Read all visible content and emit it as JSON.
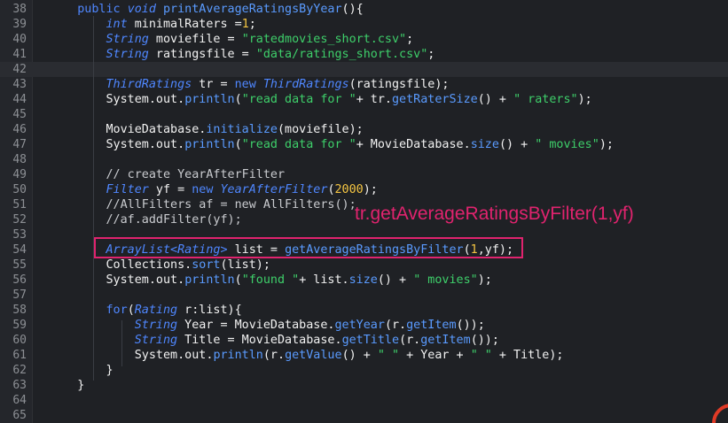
{
  "editor": {
    "current_line": "42",
    "lines": [
      {
        "num": "38",
        "tokens": [
          {
            "t": "    ",
            "c": "pl"
          },
          {
            "t": "public",
            "c": "kw"
          },
          {
            "t": " ",
            "c": "pl"
          },
          {
            "t": "void",
            "c": "ty"
          },
          {
            "t": " ",
            "c": "pl"
          },
          {
            "t": "printAverageRatingsByYear",
            "c": "fn"
          },
          {
            "t": "(){",
            "c": "pl"
          }
        ]
      },
      {
        "num": "39",
        "tokens": [
          {
            "t": "        ",
            "c": "pl"
          },
          {
            "t": "int",
            "c": "ty"
          },
          {
            "t": " minimalRaters ",
            "c": "pl"
          },
          {
            "t": "=",
            "c": "pl"
          },
          {
            "t": "1",
            "c": "nm"
          },
          {
            "t": ";",
            "c": "pl"
          }
        ]
      },
      {
        "num": "40",
        "tokens": [
          {
            "t": "        ",
            "c": "pl"
          },
          {
            "t": "String",
            "c": "ty"
          },
          {
            "t": " moviefile = ",
            "c": "pl"
          },
          {
            "t": "\"ratedmovies_short.csv\"",
            "c": "st"
          },
          {
            "t": ";",
            "c": "pl"
          }
        ]
      },
      {
        "num": "41",
        "tokens": [
          {
            "t": "        ",
            "c": "pl"
          },
          {
            "t": "String",
            "c": "ty"
          },
          {
            "t": " ratingsfile = ",
            "c": "pl"
          },
          {
            "t": "\"data/ratings_short.csv\"",
            "c": "st"
          },
          {
            "t": ";",
            "c": "pl"
          }
        ]
      },
      {
        "num": "42",
        "tokens": []
      },
      {
        "num": "43",
        "tokens": [
          {
            "t": "        ",
            "c": "pl"
          },
          {
            "t": "ThirdRatings",
            "c": "ty"
          },
          {
            "t": " tr = ",
            "c": "pl"
          },
          {
            "t": "new",
            "c": "kw"
          },
          {
            "t": " ",
            "c": "pl"
          },
          {
            "t": "ThirdRatings",
            "c": "ty"
          },
          {
            "t": "(ratingsfile);",
            "c": "pl"
          }
        ]
      },
      {
        "num": "44",
        "tokens": [
          {
            "t": "        System.out.",
            "c": "pl"
          },
          {
            "t": "println",
            "c": "fn"
          },
          {
            "t": "(",
            "c": "pl"
          },
          {
            "t": "\"read data for \"",
            "c": "st"
          },
          {
            "t": "+ tr.",
            "c": "pl"
          },
          {
            "t": "getRaterSize",
            "c": "fn"
          },
          {
            "t": "() + ",
            "c": "pl"
          },
          {
            "t": "\" raters\"",
            "c": "st"
          },
          {
            "t": ");",
            "c": "pl"
          }
        ]
      },
      {
        "num": "45",
        "tokens": []
      },
      {
        "num": "46",
        "tokens": [
          {
            "t": "        MovieDatabase.",
            "c": "pl"
          },
          {
            "t": "initialize",
            "c": "fn"
          },
          {
            "t": "(moviefile);",
            "c": "pl"
          }
        ]
      },
      {
        "num": "47",
        "tokens": [
          {
            "t": "        System.out.",
            "c": "pl"
          },
          {
            "t": "println",
            "c": "fn"
          },
          {
            "t": "(",
            "c": "pl"
          },
          {
            "t": "\"read data for \"",
            "c": "st"
          },
          {
            "t": "+ MovieDatabase.",
            "c": "pl"
          },
          {
            "t": "size",
            "c": "fn"
          },
          {
            "t": "() + ",
            "c": "pl"
          },
          {
            "t": "\" movies\"",
            "c": "st"
          },
          {
            "t": ");",
            "c": "pl"
          }
        ]
      },
      {
        "num": "48",
        "tokens": []
      },
      {
        "num": "49",
        "tokens": [
          {
            "t": "        // create YearAfterFilter",
            "c": "cm"
          }
        ]
      },
      {
        "num": "50",
        "tokens": [
          {
            "t": "        ",
            "c": "pl"
          },
          {
            "t": "Filter",
            "c": "ty"
          },
          {
            "t": " yf = ",
            "c": "pl"
          },
          {
            "t": "new",
            "c": "kw"
          },
          {
            "t": " ",
            "c": "pl"
          },
          {
            "t": "YearAfterFilter",
            "c": "ty"
          },
          {
            "t": "(",
            "c": "pl"
          },
          {
            "t": "2000",
            "c": "nm"
          },
          {
            "t": ");",
            "c": "pl"
          }
        ]
      },
      {
        "num": "51",
        "tokens": [
          {
            "t": "        //AllFilters af = new AllFilters();",
            "c": "cm"
          }
        ]
      },
      {
        "num": "52",
        "tokens": [
          {
            "t": "        //af.addFilter(yf);",
            "c": "cm"
          }
        ]
      },
      {
        "num": "53",
        "tokens": []
      },
      {
        "num": "54",
        "tokens": [
          {
            "t": "        ",
            "c": "pl"
          },
          {
            "t": "ArrayList<Rating>",
            "c": "ty"
          },
          {
            "t": " list = ",
            "c": "pl"
          },
          {
            "t": "getAverageRatingsByFilter",
            "c": "fn"
          },
          {
            "t": "(",
            "c": "pl"
          },
          {
            "t": "1",
            "c": "nm"
          },
          {
            "t": ",yf);",
            "c": "pl"
          }
        ]
      },
      {
        "num": "55",
        "tokens": [
          {
            "t": "        Collections.",
            "c": "pl"
          },
          {
            "t": "sort",
            "c": "fn"
          },
          {
            "t": "(list);",
            "c": "pl"
          }
        ]
      },
      {
        "num": "56",
        "tokens": [
          {
            "t": "        System.out.",
            "c": "pl"
          },
          {
            "t": "println",
            "c": "fn"
          },
          {
            "t": "(",
            "c": "pl"
          },
          {
            "t": "\"found \"",
            "c": "st"
          },
          {
            "t": "+ list.",
            "c": "pl"
          },
          {
            "t": "size",
            "c": "fn"
          },
          {
            "t": "() + ",
            "c": "pl"
          },
          {
            "t": "\" movies\"",
            "c": "st"
          },
          {
            "t": ");",
            "c": "pl"
          }
        ]
      },
      {
        "num": "57",
        "tokens": []
      },
      {
        "num": "58",
        "tokens": [
          {
            "t": "        ",
            "c": "pl"
          },
          {
            "t": "for",
            "c": "kw"
          },
          {
            "t": "(",
            "c": "pl"
          },
          {
            "t": "Rating",
            "c": "ty"
          },
          {
            "t": " r:list){",
            "c": "pl"
          }
        ]
      },
      {
        "num": "59",
        "tokens": [
          {
            "t": "            ",
            "c": "pl"
          },
          {
            "t": "String",
            "c": "ty"
          },
          {
            "t": " Year = MovieDatabase.",
            "c": "pl"
          },
          {
            "t": "getYear",
            "c": "fn"
          },
          {
            "t": "(r.",
            "c": "pl"
          },
          {
            "t": "getItem",
            "c": "fn"
          },
          {
            "t": "());",
            "c": "pl"
          }
        ]
      },
      {
        "num": "60",
        "tokens": [
          {
            "t": "            ",
            "c": "pl"
          },
          {
            "t": "String",
            "c": "ty"
          },
          {
            "t": " Title = MovieDatabase.",
            "c": "pl"
          },
          {
            "t": "getTitle",
            "c": "fn"
          },
          {
            "t": "(r.",
            "c": "pl"
          },
          {
            "t": "getItem",
            "c": "fn"
          },
          {
            "t": "());",
            "c": "pl"
          }
        ]
      },
      {
        "num": "61",
        "tokens": [
          {
            "t": "            System.out.",
            "c": "pl"
          },
          {
            "t": "println",
            "c": "fn"
          },
          {
            "t": "(r.",
            "c": "pl"
          },
          {
            "t": "getValue",
            "c": "fn"
          },
          {
            "t": "() + ",
            "c": "pl"
          },
          {
            "t": "\" \"",
            "c": "st"
          },
          {
            "t": " + Year + ",
            "c": "pl"
          },
          {
            "t": "\" \"",
            "c": "st"
          },
          {
            "t": " + Title);",
            "c": "pl"
          }
        ]
      },
      {
        "num": "62",
        "tokens": [
          {
            "t": "        }",
            "c": "pl"
          }
        ]
      },
      {
        "num": "63",
        "tokens": [
          {
            "t": "    }",
            "c": "pl"
          }
        ]
      },
      {
        "num": "64",
        "tokens": []
      },
      {
        "num": "65",
        "tokens": []
      }
    ]
  },
  "annotation": {
    "text": "tr.getAverageRatingsByFilter(1,yf)",
    "color": "#e0236e"
  },
  "colors": {
    "background": "#1f2125",
    "keyword": "#4f87ff",
    "string": "#3ecf6a",
    "number": "#f4c542",
    "highlight_box": "#e0236e"
  }
}
